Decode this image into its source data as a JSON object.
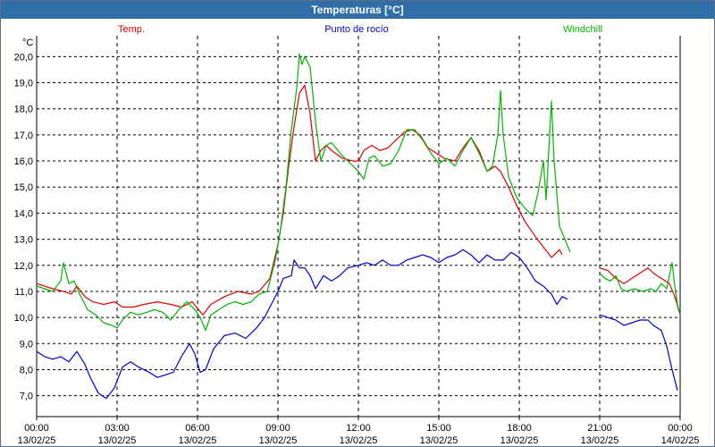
{
  "window": {
    "title": "Temperaturas [°C]"
  },
  "colors": {
    "temp": "#e00000",
    "dew": "#0000cc",
    "wind": "#00b400",
    "titlebar": "#2f6ea6"
  },
  "chart_data": {
    "type": "line",
    "title": "Temperaturas [°C]",
    "ylabel": "°C",
    "ylim": [
      6.2,
      20.8
    ],
    "yticks": [
      "20,0",
      "19,0",
      "18,0",
      "17,0",
      "16,0",
      "15,0",
      "14,0",
      "13,0",
      "12,0",
      "11,0",
      "10,0",
      "9,0",
      "8,0",
      "7,0"
    ],
    "xticks": [
      {
        "time": "00:00",
        "date": "13/02/25"
      },
      {
        "time": "03:00",
        "date": "13/02/25"
      },
      {
        "time": "06:00",
        "date": "13/02/25"
      },
      {
        "time": "09:00",
        "date": "13/02/25"
      },
      {
        "time": "12:00",
        "date": "13/02/25"
      },
      {
        "time": "15:00",
        "date": "13/02/25"
      },
      {
        "time": "18:00",
        "date": "13/02/25"
      },
      {
        "time": "21:00",
        "date": "13/02/25"
      },
      {
        "time": "00:00",
        "date": "14/02/25"
      }
    ],
    "grid": true,
    "legend": "top",
    "series": [
      {
        "name": "Temp.",
        "segments": [
          [
            [
              0,
              11.3
            ],
            [
              0.3,
              11.2
            ],
            [
              0.6,
              11.1
            ],
            [
              1,
              11.0
            ],
            [
              1.3,
              10.9
            ],
            [
              1.5,
              11.2
            ],
            [
              1.8,
              10.8
            ],
            [
              2.1,
              10.6
            ],
            [
              2.5,
              10.5
            ],
            [
              2.9,
              10.6
            ],
            [
              3.2,
              10.4
            ],
            [
              3.6,
              10.4
            ],
            [
              4,
              10.5
            ],
            [
              4.5,
              10.6
            ],
            [
              5,
              10.5
            ],
            [
              5.4,
              10.4
            ],
            [
              5.8,
              10.6
            ],
            [
              6.2,
              10.1
            ],
            [
              6.5,
              10.5
            ],
            [
              7,
              10.8
            ],
            [
              7.5,
              11.0
            ],
            [
              8,
              10.9
            ],
            [
              8.3,
              11.0
            ],
            [
              8.7,
              11.5
            ],
            [
              9.0,
              12.8
            ],
            [
              9.2,
              14.0
            ],
            [
              9.4,
              15.8
            ],
            [
              9.6,
              17.3
            ],
            [
              9.8,
              18.6
            ],
            [
              10.0,
              18.9
            ],
            [
              10.2,
              17.8
            ],
            [
              10.4,
              16.0
            ],
            [
              10.6,
              16.4
            ],
            [
              10.8,
              16.6
            ],
            [
              11.0,
              16.4
            ],
            [
              11.4,
              16.1
            ],
            [
              11.8,
              16.0
            ],
            [
              12.0,
              16.0
            ],
            [
              12.2,
              16.4
            ],
            [
              12.5,
              16.6
            ],
            [
              12.8,
              16.4
            ],
            [
              13.1,
              16.5
            ],
            [
              13.4,
              16.8
            ],
            [
              13.7,
              17.1
            ],
            [
              14.0,
              17.2
            ],
            [
              14.3,
              17.0
            ],
            [
              14.6,
              16.5
            ],
            [
              14.9,
              16.3
            ],
            [
              15.2,
              16.1
            ],
            [
              15.6,
              16.0
            ],
            [
              15.9,
              16.5
            ],
            [
              16.2,
              16.9
            ],
            [
              16.5,
              16.4
            ],
            [
              16.8,
              15.6
            ],
            [
              17.1,
              15.8
            ],
            [
              17.3,
              15.6
            ],
            [
              17.6,
              15.0
            ],
            [
              17.9,
              14.3
            ],
            [
              18.2,
              13.7
            ],
            [
              18.6,
              13.1
            ],
            [
              18.9,
              12.7
            ],
            [
              19.2,
              12.3
            ],
            [
              19.5,
              12.6
            ],
            [
              19.6,
              12.4
            ]
          ],
          [
            [
              21.0,
              11.9
            ],
            [
              21.3,
              11.8
            ],
            [
              21.6,
              11.5
            ],
            [
              21.9,
              11.3
            ],
            [
              22.2,
              11.5
            ],
            [
              22.5,
              11.7
            ],
            [
              22.8,
              11.9
            ],
            [
              23.0,
              11.7
            ],
            [
              23.3,
              11.5
            ],
            [
              23.6,
              11.3
            ],
            [
              23.8,
              10.8
            ],
            [
              24.0,
              10.1
            ]
          ]
        ]
      },
      {
        "name": "Punto de rocío",
        "segments": [
          [
            [
              0,
              8.7
            ],
            [
              0.3,
              8.5
            ],
            [
              0.6,
              8.4
            ],
            [
              0.9,
              8.5
            ],
            [
              1.2,
              8.3
            ],
            [
              1.5,
              8.7
            ],
            [
              1.8,
              8.2
            ],
            [
              2.0,
              7.7
            ],
            [
              2.3,
              7.1
            ],
            [
              2.6,
              6.9
            ],
            [
              2.9,
              7.3
            ],
            [
              3.2,
              8.1
            ],
            [
              3.5,
              8.3
            ],
            [
              3.8,
              8.1
            ],
            [
              4.2,
              7.9
            ],
            [
              4.5,
              7.7
            ],
            [
              4.8,
              7.8
            ],
            [
              5.1,
              7.9
            ],
            [
              5.4,
              8.5
            ],
            [
              5.7,
              9.0
            ],
            [
              5.9,
              8.6
            ],
            [
              6.1,
              7.9
            ],
            [
              6.3,
              8.0
            ],
            [
              6.6,
              8.8
            ],
            [
              7.0,
              9.3
            ],
            [
              7.4,
              9.4
            ],
            [
              7.8,
              9.2
            ],
            [
              8.2,
              9.6
            ],
            [
              8.5,
              10.0
            ],
            [
              8.8,
              10.6
            ],
            [
              9.0,
              11.0
            ],
            [
              9.2,
              11.5
            ],
            [
              9.5,
              11.6
            ],
            [
              9.6,
              12.2
            ],
            [
              9.8,
              11.9
            ],
            [
              10.0,
              11.9
            ],
            [
              10.2,
              11.6
            ],
            [
              10.4,
              11.1
            ],
            [
              10.7,
              11.6
            ],
            [
              11.0,
              11.4
            ],
            [
              11.3,
              11.6
            ],
            [
              11.6,
              11.9
            ],
            [
              12.0,
              12.0
            ],
            [
              12.3,
              12.1
            ],
            [
              12.6,
              12.0
            ],
            [
              12.9,
              12.2
            ],
            [
              13.2,
              12.0
            ],
            [
              13.5,
              12.0
            ],
            [
              13.8,
              12.2
            ],
            [
              14.1,
              12.3
            ],
            [
              14.4,
              12.4
            ],
            [
              14.7,
              12.3
            ],
            [
              15.0,
              12.1
            ],
            [
              15.3,
              12.3
            ],
            [
              15.6,
              12.4
            ],
            [
              15.9,
              12.6
            ],
            [
              16.2,
              12.4
            ],
            [
              16.5,
              12.1
            ],
            [
              16.8,
              12.4
            ],
            [
              17.1,
              12.2
            ],
            [
              17.4,
              12.2
            ],
            [
              17.7,
              12.5
            ],
            [
              18.0,
              12.3
            ],
            [
              18.3,
              11.9
            ],
            [
              18.6,
              11.4
            ],
            [
              18.9,
              11.2
            ],
            [
              19.2,
              10.9
            ],
            [
              19.4,
              10.5
            ],
            [
              19.6,
              10.8
            ],
            [
              19.8,
              10.7
            ]
          ],
          [
            [
              21.0,
              10.1
            ],
            [
              21.3,
              10.0
            ],
            [
              21.6,
              9.9
            ],
            [
              21.9,
              9.7
            ],
            [
              22.2,
              9.8
            ],
            [
              22.5,
              9.9
            ],
            [
              22.8,
              9.9
            ],
            [
              23.0,
              9.7
            ],
            [
              23.3,
              9.5
            ],
            [
              23.5,
              8.9
            ],
            [
              23.7,
              8.0
            ],
            [
              23.9,
              7.2
            ]
          ]
        ]
      },
      {
        "name": "Windchill",
        "segments": [
          [
            [
              0,
              11.2
            ],
            [
              0.3,
              11.1
            ],
            [
              0.6,
              11.0
            ],
            [
              0.9,
              11.4
            ],
            [
              1.0,
              12.1
            ],
            [
              1.2,
              11.3
            ],
            [
              1.4,
              11.4
            ],
            [
              1.6,
              10.9
            ],
            [
              1.9,
              10.3
            ],
            [
              2.2,
              10.1
            ],
            [
              2.5,
              9.8
            ],
            [
              2.8,
              9.7
            ],
            [
              3.0,
              9.6
            ],
            [
              3.2,
              9.9
            ],
            [
              3.5,
              10.2
            ],
            [
              3.8,
              10.1
            ],
            [
              4.1,
              10.2
            ],
            [
              4.4,
              10.3
            ],
            [
              4.7,
              10.2
            ],
            [
              5.0,
              9.9
            ],
            [
              5.3,
              10.3
            ],
            [
              5.6,
              10.6
            ],
            [
              5.9,
              10.3
            ],
            [
              6.1,
              10.0
            ],
            [
              6.3,
              9.5
            ],
            [
              6.5,
              10.1
            ],
            [
              6.8,
              10.3
            ],
            [
              7.1,
              10.5
            ],
            [
              7.4,
              10.6
            ],
            [
              7.7,
              10.5
            ],
            [
              8.0,
              10.6
            ],
            [
              8.3,
              10.9
            ],
            [
              8.6,
              11.0
            ],
            [
              8.9,
              12.2
            ],
            [
              9.1,
              13.4
            ],
            [
              9.3,
              15.0
            ],
            [
              9.5,
              17.2
            ],
            [
              9.7,
              18.8
            ],
            [
              9.8,
              20.1
            ],
            [
              9.9,
              19.7
            ],
            [
              10.0,
              20.0
            ],
            [
              10.2,
              19.6
            ],
            [
              10.4,
              17.5
            ],
            [
              10.6,
              16.0
            ],
            [
              10.8,
              16.6
            ],
            [
              11.0,
              16.7
            ],
            [
              11.4,
              16.2
            ],
            [
              11.7,
              15.9
            ],
            [
              12.0,
              15.6
            ],
            [
              12.2,
              15.3
            ],
            [
              12.4,
              16.1
            ],
            [
              12.6,
              16.2
            ],
            [
              12.9,
              15.8
            ],
            [
              13.2,
              15.9
            ],
            [
              13.5,
              16.4
            ],
            [
              13.8,
              17.2
            ],
            [
              14.1,
              17.2
            ],
            [
              14.4,
              16.8
            ],
            [
              14.7,
              16.3
            ],
            [
              15.0,
              15.9
            ],
            [
              15.3,
              16.1
            ],
            [
              15.6,
              15.8
            ],
            [
              15.9,
              16.4
            ],
            [
              16.2,
              16.9
            ],
            [
              16.5,
              16.3
            ],
            [
              16.8,
              15.6
            ],
            [
              17.0,
              15.8
            ],
            [
              17.2,
              17.0
            ],
            [
              17.3,
              18.7
            ],
            [
              17.4,
              17.0
            ],
            [
              17.6,
              15.4
            ],
            [
              17.9,
              14.6
            ],
            [
              18.2,
              14.2
            ],
            [
              18.5,
              13.9
            ],
            [
              18.7,
              14.8
            ],
            [
              18.9,
              16.0
            ],
            [
              19.0,
              14.5
            ],
            [
              19.2,
              18.3
            ],
            [
              19.3,
              16.0
            ],
            [
              19.5,
              13.5
            ],
            [
              19.7,
              13.0
            ],
            [
              19.9,
              12.5
            ]
          ],
          [
            [
              21.0,
              11.7
            ],
            [
              21.2,
              11.5
            ],
            [
              21.4,
              11.4
            ],
            [
              21.6,
              11.6
            ],
            [
              21.8,
              11.1
            ],
            [
              22.0,
              11.0
            ],
            [
              22.3,
              11.1
            ],
            [
              22.6,
              11.0
            ],
            [
              22.9,
              11.1
            ],
            [
              23.1,
              11.0
            ],
            [
              23.3,
              11.3
            ],
            [
              23.5,
              11.1
            ],
            [
              23.7,
              12.1
            ],
            [
              23.8,
              11.2
            ],
            [
              23.9,
              10.5
            ],
            [
              24.0,
              10.1
            ]
          ]
        ]
      }
    ]
  }
}
